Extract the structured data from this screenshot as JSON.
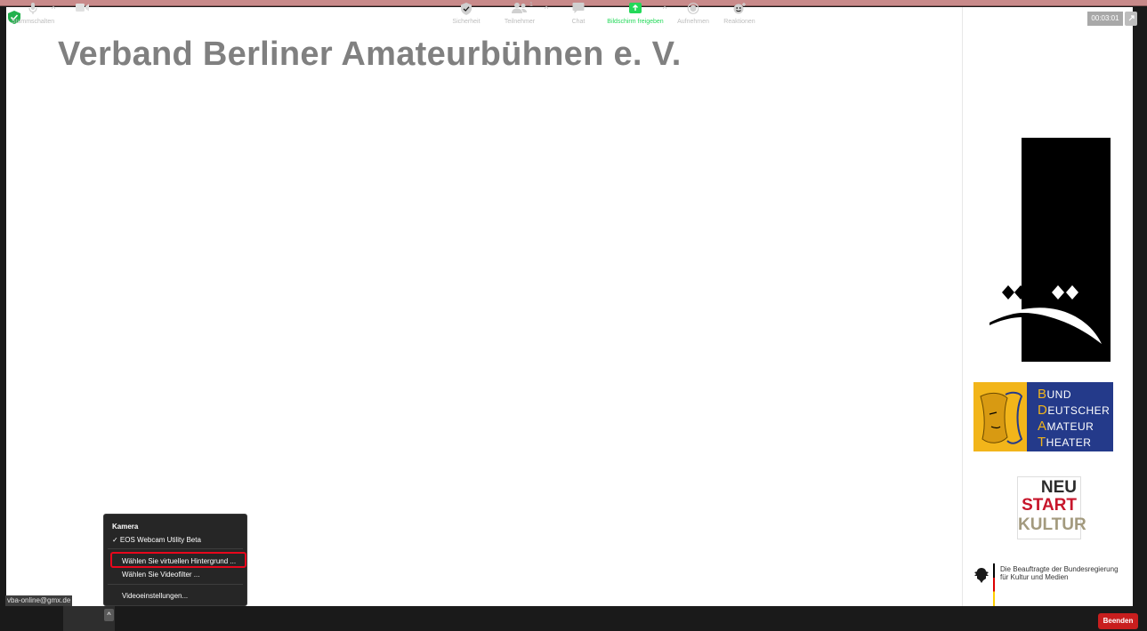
{
  "window": {
    "timer": "00:03:01"
  },
  "slide": {
    "title": "Verband Berliner Amateurbühnen e. V."
  },
  "logos": {
    "bdat": {
      "lines": [
        {
          "cap": "B",
          "rest": "UND"
        },
        {
          "cap": "D",
          "rest": "EUTSCHER"
        },
        {
          "cap": "A",
          "rest": "MATEUR"
        },
        {
          "cap": "T",
          "rest": "HEATER"
        }
      ]
    },
    "neustart": {
      "line1": "NEU",
      "line2": "START",
      "line3": "KULTUR"
    },
    "government": {
      "line1": "Die Beauftragte der Bundesregierung",
      "line2": "für Kultur und Medien"
    }
  },
  "camera_menu": {
    "title": "Kamera",
    "items": [
      {
        "label": "✓ EOS Webcam Utility Beta"
      },
      {
        "label": "Wählen Sie virtuellen Hintergrund ..."
      },
      {
        "label": "Wählen Sie Videofilter ..."
      },
      {
        "label": "Videoeinstellungen..."
      }
    ]
  },
  "user_label": "vba-online@gmx.de",
  "toolbar": {
    "mute": "Stummschalten",
    "video": "Video beenden",
    "security": "Sicherheit",
    "participants": "Teilnehmer",
    "participants_count": "1",
    "chat": "Chat",
    "share": "Bildschirm freigeben",
    "record": "Aufnehmen",
    "reactions": "Reaktionen",
    "end": "Beenden"
  },
  "colors": {
    "accent_green": "#23d959",
    "end_red": "#c81e1e",
    "highlight_red": "#e8071c",
    "bdat_blue": "#243a8a",
    "bdat_gold": "#f2b51a"
  }
}
